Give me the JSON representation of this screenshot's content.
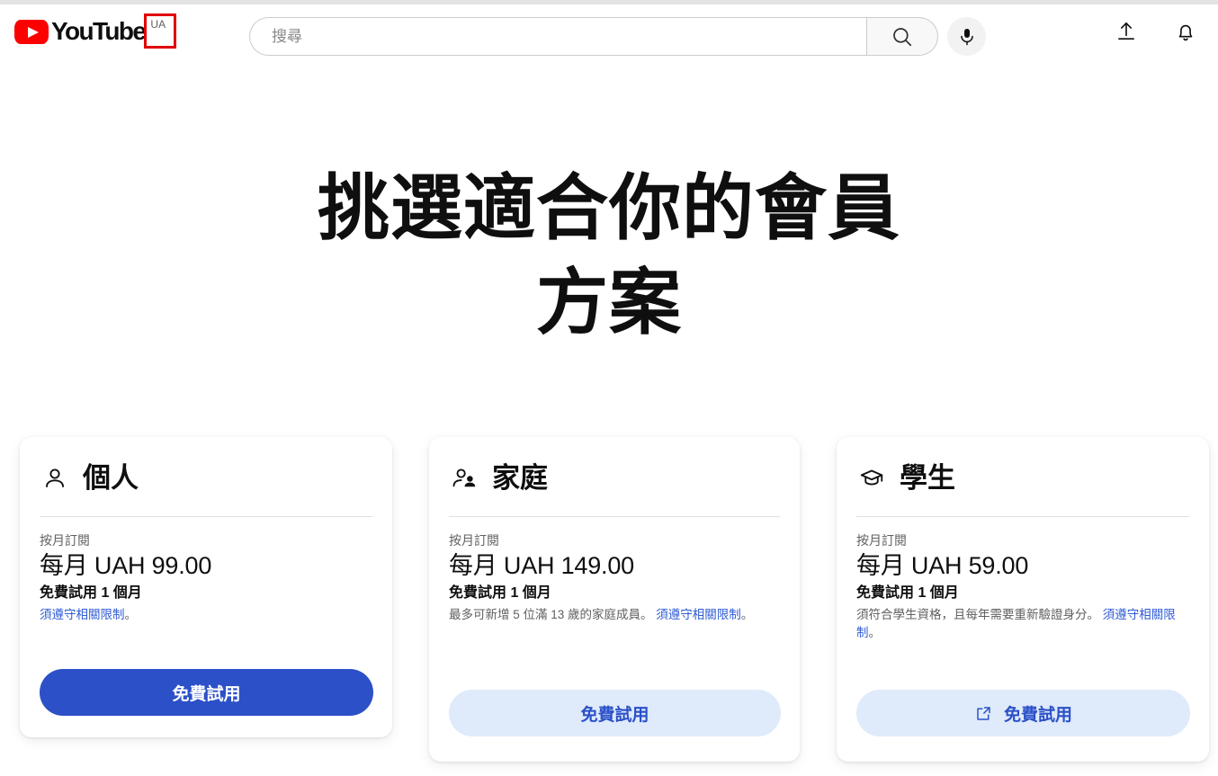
{
  "header": {
    "logo_text": "YouTube",
    "country_code": "UA",
    "search_placeholder": "搜尋",
    "search_value": "",
    "icons": {
      "search": "search-icon",
      "mic": "microphone-icon",
      "upload": "upload-icon",
      "notifications": "bell-icon"
    }
  },
  "page": {
    "title_line1": "挑選適合你的會員",
    "title_line2": "方案"
  },
  "plans": [
    {
      "icon": "person-icon",
      "name": "個人",
      "billing_period": "按月訂閱",
      "price": "每月 UAH 99.00",
      "trial": "免費試用 1 個月",
      "fineprint_text": "",
      "fineprint_link": "須遵守相關限制",
      "fineprint_suffix": "。",
      "cta_label": "免費試用",
      "cta_style": "primary",
      "cta_icon": ""
    },
    {
      "icon": "people-icon",
      "name": "家庭",
      "billing_period": "按月訂閱",
      "price": "每月 UAH 149.00",
      "trial": "免費試用 1 個月",
      "fineprint_text": "最多可新增 5 位滿 13 歲的家庭成員。 ",
      "fineprint_link": "須遵守相關限制",
      "fineprint_suffix": "。",
      "cta_label": "免費試用",
      "cta_style": "secondary",
      "cta_icon": ""
    },
    {
      "icon": "graduation-cap-icon",
      "name": "學生",
      "billing_period": "按月訂閱",
      "price": "每月 UAH 59.00",
      "trial": "免費試用 1 個月",
      "fineprint_text": "須符合學生資格，且每年需要重新驗證身分。 ",
      "fineprint_link": "須遵守相關限制",
      "fineprint_suffix": "。",
      "cta_label": "免費試用",
      "cta_style": "secondary",
      "cta_icon": "external-link-icon"
    }
  ],
  "colors": {
    "brand_red": "#ff0000",
    "accent_blue": "#2b50c8",
    "accent_blue_light": "#dfeafb",
    "link_blue": "#2f5bd4",
    "annotation_red": "#e00000",
    "text_primary": "#0f0f0f",
    "text_secondary": "#606060"
  }
}
